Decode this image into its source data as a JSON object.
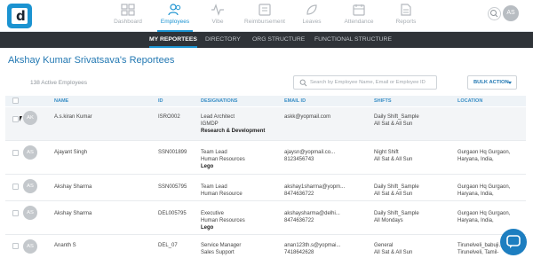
{
  "nav": {
    "logo_letter": "d",
    "items": [
      {
        "label": "Dashboard",
        "icon": "dashboard-icon",
        "active": false
      },
      {
        "label": "Employees",
        "icon": "employees-icon",
        "active": true
      },
      {
        "label": "Vibe",
        "icon": "vibe-icon",
        "active": false
      },
      {
        "label": "Reimbursement",
        "icon": "reimbursement-icon",
        "active": false
      },
      {
        "label": "Leaves",
        "icon": "leaves-icon",
        "active": false
      },
      {
        "label": "Attendance",
        "icon": "attendance-icon",
        "active": false
      },
      {
        "label": "Reports",
        "icon": "reports-icon",
        "active": false
      }
    ],
    "user_initials": "AS"
  },
  "subnav": {
    "tabs": [
      {
        "label": "MY REPORTEES",
        "active": true
      },
      {
        "label": "DIRECTORY",
        "active": false
      },
      {
        "label": "ORG STRUCTURE",
        "active": false
      },
      {
        "label": "FUNCTIONAL STRUCTURE",
        "active": false
      }
    ]
  },
  "page": {
    "title": "Akshay Kumar Srivatsava's Reportees",
    "active_count": "138 Active Employees",
    "search_placeholder": "Search by Employee Name, Email or Employee ID",
    "bulk_action": "BULK ACTION"
  },
  "table": {
    "columns": [
      "NAME",
      "ID",
      "DESIGNATIONS",
      "EMAIL ID",
      "SHIFTS",
      "LOCATION"
    ],
    "rows": [
      {
        "initials": "AK",
        "name": "A.s.kiran Kumar",
        "id": "ISRO002",
        "designation": [
          "Lead Architect",
          "IGMDP"
        ],
        "department": "Research & Development",
        "email": "askk@yopmail.com",
        "phone": "",
        "shift": [
          "Daily Shift_Sample",
          "All Sat & All Sun"
        ],
        "location": []
      },
      {
        "initials": "AS",
        "name": "Ajayant Singh",
        "id": "SSN001899",
        "designation": [
          "Team Lead",
          "Human Resources"
        ],
        "department": "Lego",
        "email": "ajaysn@yopmail.co...",
        "phone": "8123456743",
        "shift": [
          "Night Shift",
          "All Sat & All Sun"
        ],
        "location": [
          "Gurgaon Hq Gurgaon,",
          "Haryana, India,"
        ]
      },
      {
        "initials": "AS",
        "name": "Akshay Sharma",
        "id": "SSN005795",
        "designation": [
          "Team Lead",
          "Human Resource"
        ],
        "department": "",
        "email": "akshay1sharma@yopm...",
        "phone": "8474636722",
        "shift": [
          "Daily Shift_Sample",
          "All Sat & All Sun"
        ],
        "location": [
          "Gurgaon Hq Gurgaon,",
          "Haryana, India,"
        ]
      },
      {
        "initials": "AS",
        "name": "Akshay Sharma",
        "id": "DEL005795",
        "designation": [
          "Executive",
          "Human Resources"
        ],
        "department": "Lego",
        "email": "akshaysharma@delhi...",
        "phone": "8474636722",
        "shift": [
          "Daily Shift_Sample",
          "All Mondays"
        ],
        "location": [
          "Gurgaon Hq Gurgaon,",
          "Haryana, India,"
        ]
      },
      {
        "initials": "AS",
        "name": "Ananth S",
        "id": "DEL_07",
        "designation": [
          "Service Manager",
          "Sales Support"
        ],
        "department": "",
        "email": "anan123th.s@yopmai...",
        "phone": "7418642628",
        "shift": [
          "General",
          "All Sat & All Sun"
        ],
        "location": [
          "Tirunelveli_babuji...",
          "Tirunelveli, Tamil-"
        ]
      }
    ]
  }
}
